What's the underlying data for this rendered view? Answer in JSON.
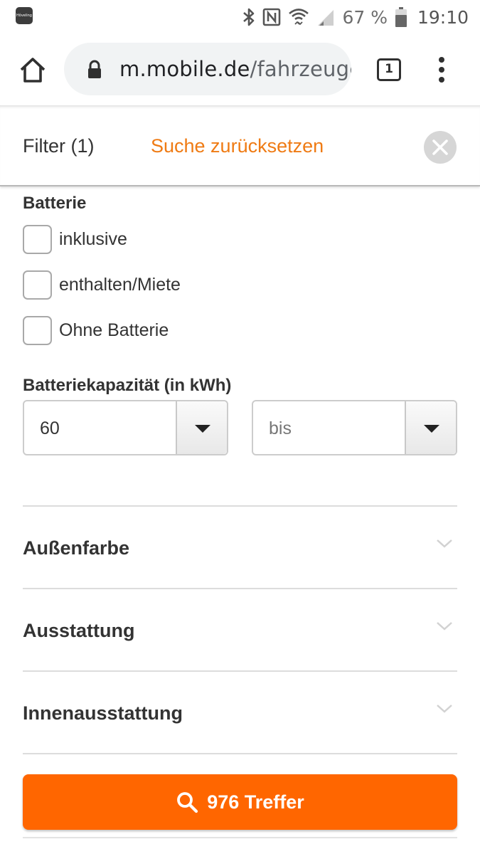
{
  "status_bar": {
    "app_thumbnail_text": "Hôveling",
    "battery_percent": "67 %",
    "time": "19:10",
    "icons": [
      "bluetooth-icon",
      "nfc-icon",
      "wifi-icon",
      "signal-icon",
      "battery-icon"
    ]
  },
  "browser": {
    "url_domain": "m.mobile.de",
    "url_path": "/fahrzeuge",
    "tab_count": "1"
  },
  "filter_header": {
    "title": "Filter (1)",
    "reset_label": "Suche zurücksetzen"
  },
  "battery": {
    "title": "Batterie",
    "options": [
      {
        "label": "inklusive",
        "checked": false
      },
      {
        "label": "enthalten/Miete",
        "checked": false
      },
      {
        "label": "Ohne Batterie",
        "checked": false
      }
    ]
  },
  "capacity": {
    "title": "Batteriekapazität (in kWh)",
    "from_value": "60",
    "to_value": "bis"
  },
  "accordion": [
    {
      "label": "Außenfarbe"
    },
    {
      "label": "Ausstattung"
    },
    {
      "label": "Innenausstattung"
    }
  ],
  "results_button": {
    "label": "976 Treffer"
  },
  "colors": {
    "accent": "#ff6600",
    "link": "#ef7b14",
    "text": "#333333"
  }
}
